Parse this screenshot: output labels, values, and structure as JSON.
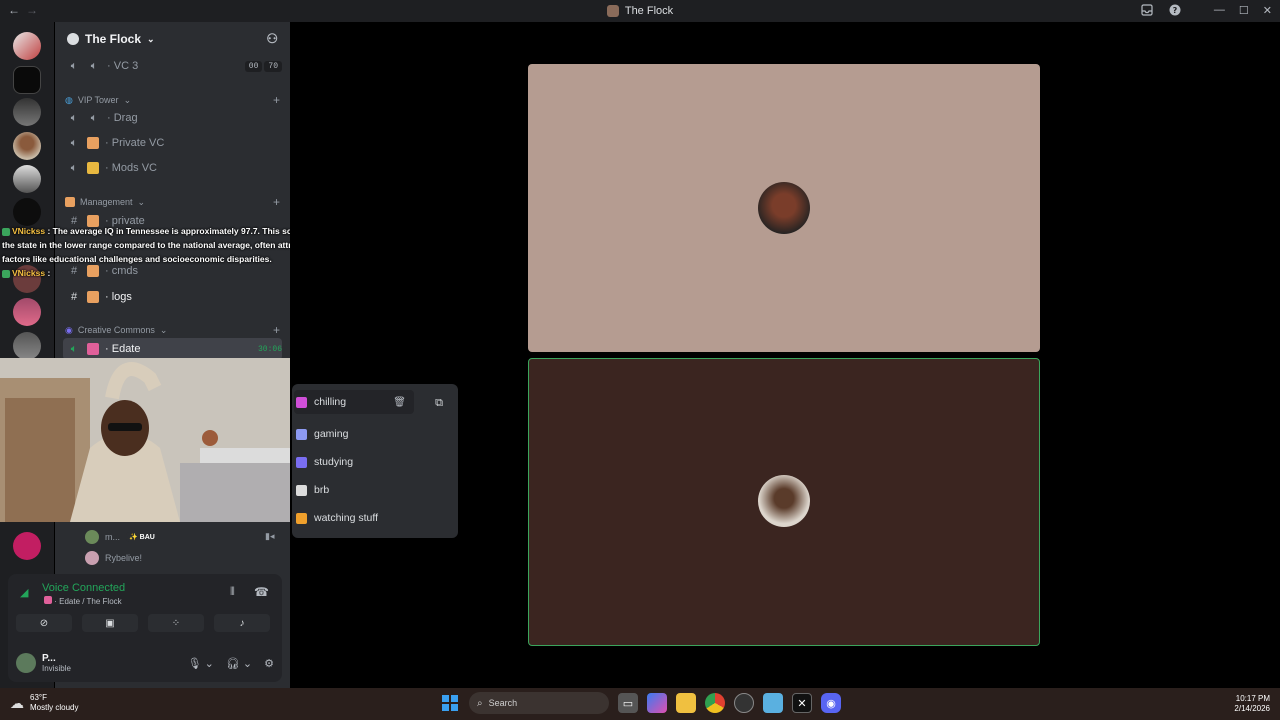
{
  "window": {
    "title": "The Flock"
  },
  "server": {
    "name": "The Flock"
  },
  "channels": {
    "vc3": {
      "label": "VC 3",
      "badge_a": "00",
      "badge_b": "70"
    },
    "cat_vip": "VIP Tower",
    "drag": "Drag",
    "private_vc": "Private VC",
    "mods_vc": "Mods VC",
    "cat_management": "Management",
    "private": "private",
    "cmds": "cmds",
    "logs": "logs",
    "cat_creative": "Creative Commons",
    "edate": {
      "label": "Edate",
      "timer": "30:06"
    }
  },
  "overlay": {
    "name1": "VNickss",
    "msg1": ": The average IQ in Tennessee is approximately 97.7. This score places the state in the lower range compared to the national average, often attributed to factors like educational challenges and socioeconomic disparities.",
    "name2": "VNickss",
    "msg2": ":"
  },
  "voice_users": [
    {
      "name": "m...",
      "tag": "BAU"
    },
    {
      "name": "Rybelive!"
    }
  ],
  "voice_panel": {
    "status": "Voice Connected",
    "subtitle": "Edate / The Flock"
  },
  "user": {
    "name": "P...",
    "status": "Invisible"
  },
  "activity_menu": {
    "items": [
      {
        "label": "chilling",
        "color": "#d04fd8"
      },
      {
        "label": "gaming",
        "color": "#8e9bf3"
      },
      {
        "label": "studying",
        "color": "#7a6ef2"
      },
      {
        "label": "brb",
        "color": "#dcdcdc"
      },
      {
        "label": "watching stuff",
        "color": "#f0a02c"
      }
    ]
  },
  "taskbar": {
    "temp": "63°F",
    "weather": "Mostly cloudy",
    "search_placeholder": "Search",
    "time": "10:17 PM",
    "date": "2/14/2026"
  }
}
